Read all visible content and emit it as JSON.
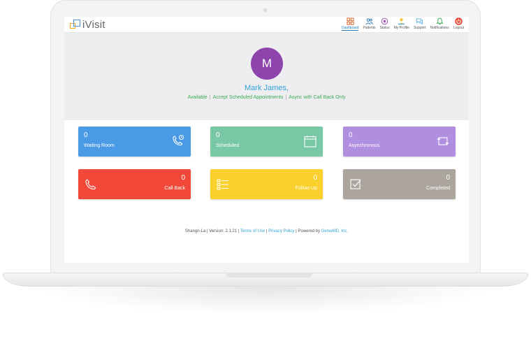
{
  "app": {
    "logo_text": "iVisit"
  },
  "nav": {
    "items": [
      {
        "label": "Dashboard",
        "icon": "dashboard-icon",
        "color": "#e0703a",
        "active": true
      },
      {
        "label": "Patients",
        "icon": "patients-icon",
        "color": "#2a7ab8"
      },
      {
        "label": "Status",
        "icon": "status-icon",
        "color": "#9b59b6"
      },
      {
        "label": "My Profile",
        "icon": "profile-icon",
        "color": "#f5c242"
      },
      {
        "label": "Support",
        "icon": "support-icon",
        "color": "#5bb0e0"
      },
      {
        "label": "Notifications",
        "icon": "bell-icon",
        "color": "#3aaa55"
      },
      {
        "label": "Logout",
        "icon": "power-icon",
        "color": "#e74c3c"
      }
    ]
  },
  "profile": {
    "initial": "M",
    "name": "Mark James,",
    "status_items": [
      "Available",
      "Accept Scheduled Appointments",
      "Async with Call Back Only"
    ]
  },
  "tiles": [
    {
      "count": "0",
      "label": "Waiting Room",
      "color": "#4a9ae6",
      "icon": "phone-clock-icon"
    },
    {
      "count": "0",
      "label": "Scheduled",
      "color": "#78c8a6",
      "icon": "calendar-icon"
    },
    {
      "count": "0",
      "label": "Asynchronous",
      "color": "#b08ee0",
      "icon": "async-icon"
    },
    {
      "count": "0",
      "label": "Call Back",
      "color": "#f2483a",
      "icon": "phone-icon"
    },
    {
      "count": "0",
      "label": "Follow Up",
      "color": "#fad02c",
      "icon": "checklist-icon"
    },
    {
      "count": "0",
      "label": "Completed",
      "color": "#aba59e",
      "icon": "checkbox-icon"
    }
  ],
  "footer": {
    "prefix": "Shangri-La | Version: 2.1.21 | ",
    "terms": "Terms of Use",
    "sep": " | ",
    "privacy": "Privacy Policy",
    "powered": " | Powered by ",
    "company": "GenieMD, Inc."
  }
}
